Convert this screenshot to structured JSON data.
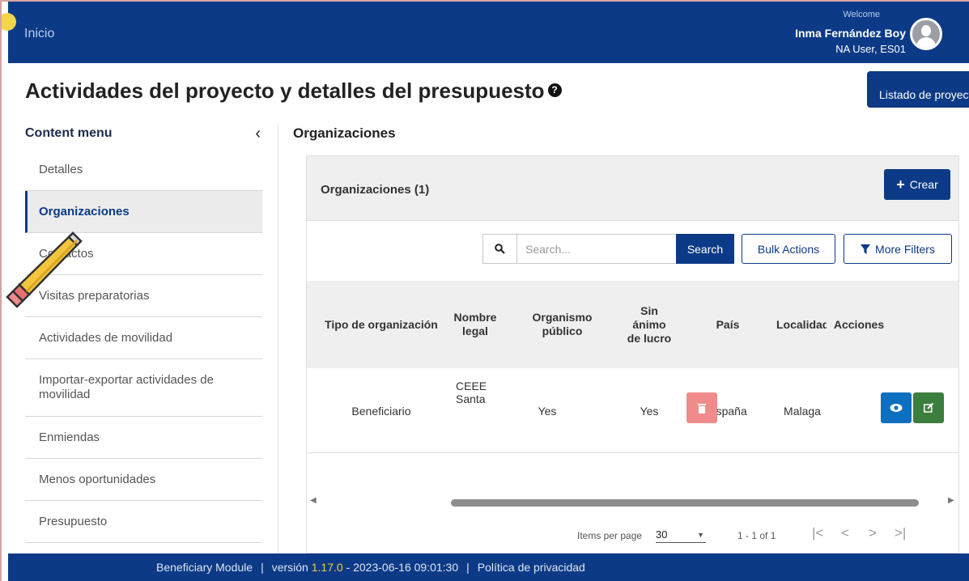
{
  "header": {
    "home_link": "Inicio",
    "welcome": "Welcome",
    "user_name": "Inma Fernández Boy",
    "user_role": "NA User, ES01"
  },
  "page": {
    "title": "Actividades del proyecto y detalles del presupuesto",
    "help_glyph": "?",
    "list_button": "Listado de proyectos"
  },
  "sidebar": {
    "title": "Content menu",
    "collapse_glyph": "‹",
    "items": [
      {
        "label": "Detalles"
      },
      {
        "label": "Organizaciones",
        "active": true
      },
      {
        "label": "Contactos"
      },
      {
        "label": "Visitas preparatorias"
      },
      {
        "label": "Actividades de movilidad"
      },
      {
        "label": "Importar-exportar actividades de movilidad"
      },
      {
        "label": "Enmiendas"
      },
      {
        "label": "Menos oportunidades"
      },
      {
        "label": "Presupuesto"
      }
    ]
  },
  "main": {
    "section_title": "Organizaciones",
    "panel_title": "Organizaciones (1)",
    "create_label": "Crear",
    "search_placeholder": "Search...",
    "search_button": "Search",
    "bulk_actions": "Bulk Actions",
    "more_filters": "More Filters",
    "columns": [
      "Tipo de organización",
      "Nombre legal",
      "Organismo público",
      "Sin ánimo de lucro",
      "País",
      "Localidad",
      "Acciones"
    ],
    "rows": [
      {
        "tipo": "Beneficiario",
        "nombre": "CEEE Santa",
        "publico": "Yes",
        "sin_animo": "Yes",
        "pais": "España",
        "localidad": "Malaga"
      }
    ],
    "pagination": {
      "items_per_page_label": "Items per page",
      "items_per_page": "30",
      "range": "1 - 1 of 1"
    }
  },
  "footer": {
    "module": "Beneficiary Module",
    "version_label": "versión",
    "version": "1.17.0",
    "build": "- 2023-06-16 09:01:30",
    "privacy": "Política de privacidad"
  },
  "colors": {
    "brand": "#0c3a86",
    "accent_version": "#f4c842",
    "delete": "#f08b8b",
    "view": "#0d6fc0",
    "edit": "#3c7e3d"
  }
}
